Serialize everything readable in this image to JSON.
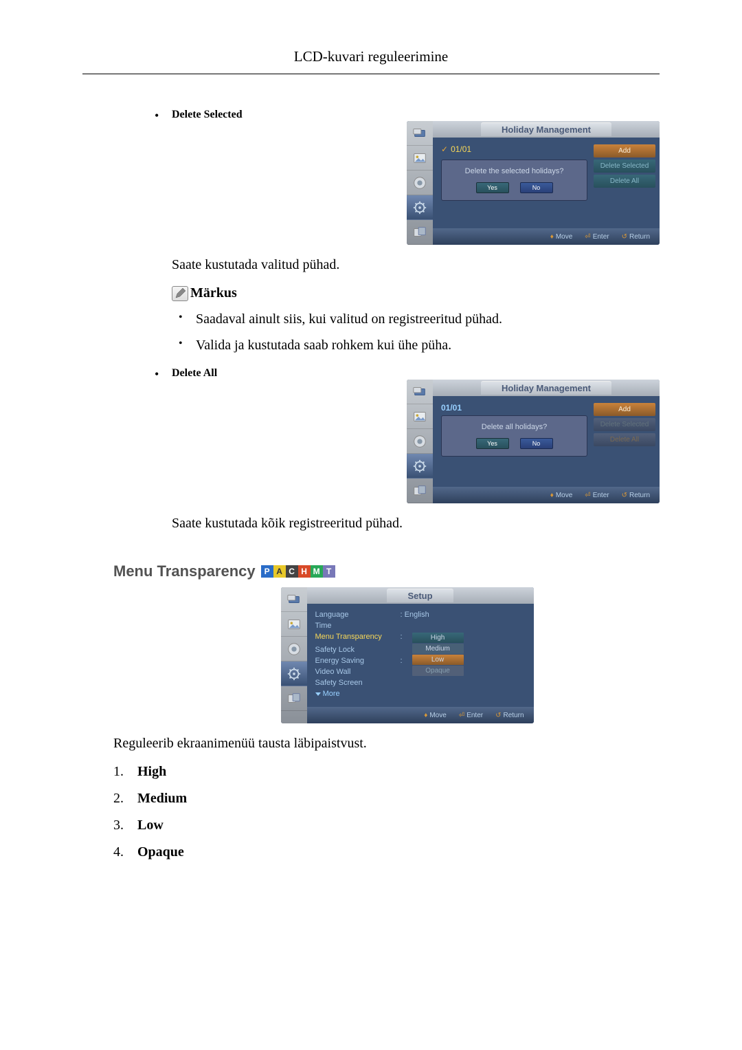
{
  "header": {
    "title": "LCD-kuvari reguleerimine"
  },
  "sections": {
    "delete_selected": {
      "heading": "Delete Selected",
      "osd": {
        "title": "Holiday Management",
        "date": "01/01",
        "dialog_question": "Delete the selected holidays?",
        "yes": "Yes",
        "no": "No",
        "buttons": {
          "add": "Add",
          "del_sel": "Delete Selected",
          "del_all": "Delete All"
        },
        "footer": {
          "move": "Move",
          "enter": "Enter",
          "return": "Return"
        }
      },
      "desc": "Saate kustutada valitud pühad.",
      "note_label": "Märkus",
      "notes": [
        "Saadaval ainult siis, kui valitud on registreeritud pühad.",
        "Valida ja kustutada saab rohkem kui ühe püha."
      ]
    },
    "delete_all": {
      "heading": "Delete All",
      "osd": {
        "title": "Holiday Management",
        "date": "01/01",
        "dialog_question": "Delete all holidays?",
        "yes": "Yes",
        "no": "No",
        "buttons": {
          "add": "Add",
          "del_sel": "Delete Selected",
          "del_all": "Delete All"
        },
        "footer": {
          "move": "Move",
          "enter": "Enter",
          "return": "Return"
        }
      },
      "desc": "Saate kustutada kõik registreeritud pühad."
    },
    "menu_transparency": {
      "heading": "Menu Transparency",
      "badges": [
        "P",
        "A",
        "C",
        "H",
        "M",
        "T"
      ],
      "osd": {
        "title": "Setup",
        "items": {
          "language": {
            "label": "Language",
            "value": "English"
          },
          "time": {
            "label": "Time"
          },
          "menu_trans": {
            "label": "Menu Transparency"
          },
          "safety_lock": {
            "label": "Safety Lock"
          },
          "energy_saving": {
            "label": "Energy Saving"
          },
          "video_wall": {
            "label": "Video Wall"
          },
          "safety_screen": {
            "label": "Safety Screen"
          },
          "more": {
            "label": "More"
          }
        },
        "options": {
          "high": "High",
          "medium": "Medium",
          "low": "Low",
          "opaque": "Opaque"
        },
        "footer": {
          "move": "Move",
          "enter": "Enter",
          "return": "Return"
        }
      },
      "desc": "Reguleerib ekraanimenüü tausta läbipaistvust.",
      "list": [
        "High",
        "Medium",
        "Low",
        "Opaque"
      ]
    }
  }
}
